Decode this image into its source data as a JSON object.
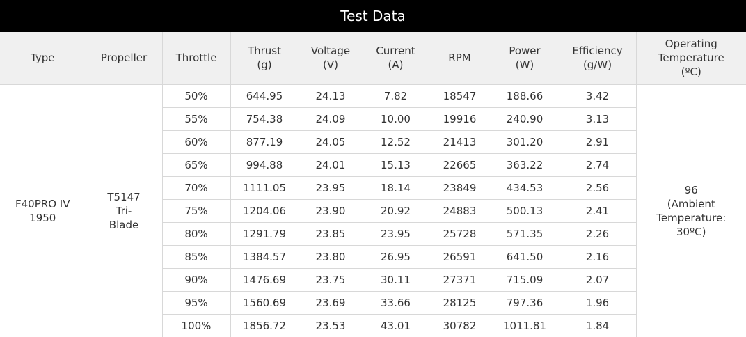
{
  "title": "Test Data",
  "headers": [
    {
      "lines": [
        "Type"
      ]
    },
    {
      "lines": [
        "Propeller"
      ]
    },
    {
      "lines": [
        "Throttle"
      ]
    },
    {
      "lines": [
        "Thrust",
        "(g)"
      ]
    },
    {
      "lines": [
        "Voltage",
        "(V)"
      ]
    },
    {
      "lines": [
        "Current",
        "(A)"
      ]
    },
    {
      "lines": [
        "RPM"
      ]
    },
    {
      "lines": [
        "Power",
        "(W)"
      ]
    },
    {
      "lines": [
        "Efficiency",
        "(g/W)"
      ]
    },
    {
      "lines": [
        "Operating",
        "Temperature",
        "(ºC)"
      ]
    }
  ],
  "type_cell": [
    "F40PRO IV",
    "1950"
  ],
  "propeller_cell": [
    "T5147",
    "Tri-",
    "Blade"
  ],
  "temperature_cell": [
    "96",
    "(Ambient",
    "Temperature:",
    "30ºC)"
  ],
  "rows": [
    [
      "50%",
      "644.95",
      "24.13",
      "7.82",
      "18547",
      "188.66",
      "3.42"
    ],
    [
      "55%",
      "754.38",
      "24.09",
      "10.00",
      "19916",
      "240.90",
      "3.13"
    ],
    [
      "60%",
      "877.19",
      "24.05",
      "12.52",
      "21413",
      "301.20",
      "2.91"
    ],
    [
      "65%",
      "994.88",
      "24.01",
      "15.13",
      "22665",
      "363.22",
      "2.74"
    ],
    [
      "70%",
      "1111.05",
      "23.95",
      "18.14",
      "23849",
      "434.53",
      "2.56"
    ],
    [
      "75%",
      "1204.06",
      "23.90",
      "20.92",
      "24883",
      "500.13",
      "2.41"
    ],
    [
      "80%",
      "1291.79",
      "23.85",
      "23.95",
      "25728",
      "571.35",
      "2.26"
    ],
    [
      "85%",
      "1384.57",
      "23.80",
      "26.95",
      "26591",
      "641.50",
      "2.16"
    ],
    [
      "90%",
      "1476.69",
      "23.75",
      "30.11",
      "27371",
      "715.09",
      "2.07"
    ],
    [
      "95%",
      "1560.69",
      "23.69",
      "33.66",
      "28125",
      "797.36",
      "1.96"
    ],
    [
      "100%",
      "1856.72",
      "23.53",
      "43.01",
      "30782",
      "1011.81",
      "1.84"
    ]
  ],
  "colors": {
    "title_bg": "#000000",
    "title_text": "#ffffff",
    "header_bg": "#f0f0f0",
    "border": "#d8d8d8",
    "text": "#333333"
  }
}
